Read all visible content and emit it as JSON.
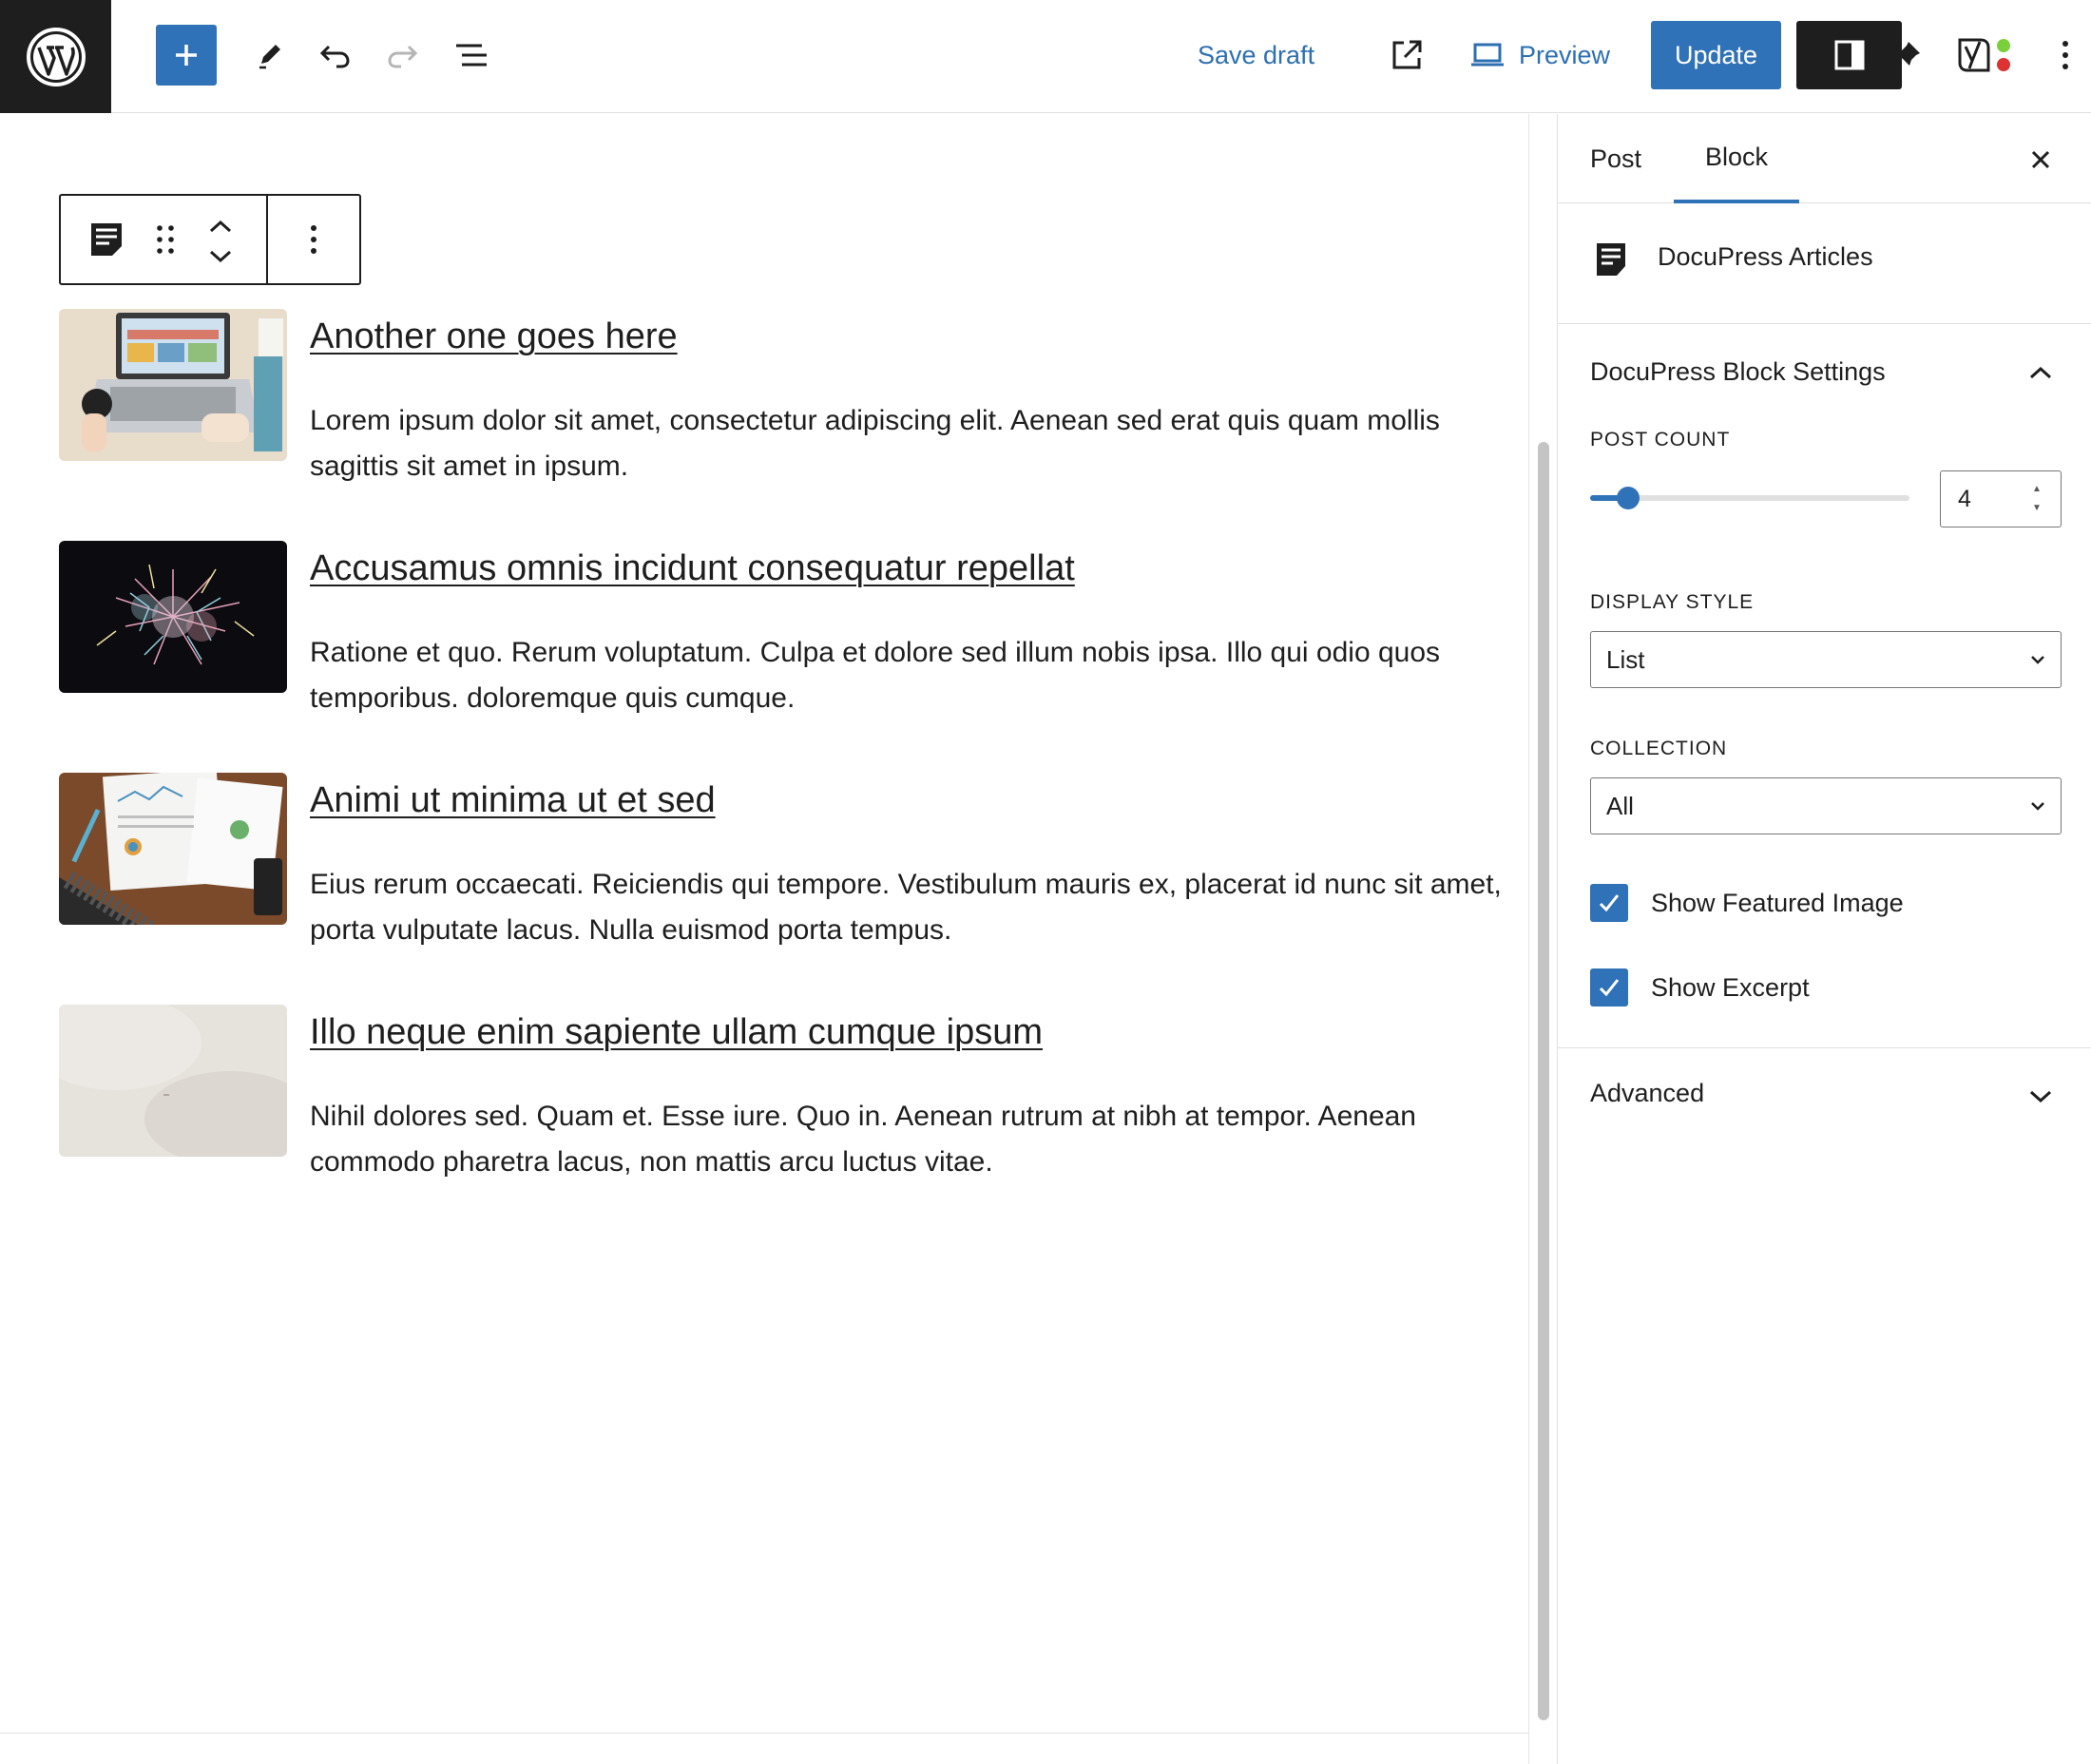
{
  "toolbar": {
    "save_draft_label": "Save draft",
    "preview_label": "Preview",
    "update_label": "Update",
    "accent_color": "#3072b8"
  },
  "articles": [
    {
      "title": "Another one goes here",
      "excerpt": "Lorem ipsum dolor sit amet, consectetur adipiscing elit. Aenean sed erat quis quam mollis sagittis sit amet in ipsum.",
      "image": "laptop-desk-photo"
    },
    {
      "title": "Accusamus omnis incidunt consequatur repellat",
      "excerpt": "Ratione et quo. Rerum voluptatum. Culpa et dolore sed illum nobis ipsa. Illo qui odio quos temporibus. doloremque quis cumque.",
      "image": "fireworks-photo"
    },
    {
      "title": "Animi ut minima ut et sed",
      "excerpt": "Eius rerum occaecati. Reiciendis qui tempore. Vestibulum mauris ex, placerat id nunc sit amet, porta vulputate lacus. Nulla euismod porta tempus.",
      "image": "analytics-papers-photo"
    },
    {
      "title": "Illo neque enim sapiente ullam cumque ipsum",
      "excerpt": "Nihil dolores sed. Quam et. Esse iure. Quo in. Aenean rutrum at nibh at tempor. Aenean commodo pharetra lacus, non mattis arcu luctus vitae.",
      "image": "pale-texture-photo"
    }
  ],
  "sidebar": {
    "tab_post": "Post",
    "tab_block": "Block",
    "block_name": "DocuPress Articles",
    "settings_panel_title": "DocuPress Block Settings",
    "post_count_label": "Post count",
    "post_count_value": "4",
    "post_count_fraction": 0.12,
    "display_style_label": "Display style",
    "display_style_value": "List",
    "collection_label": "Collection",
    "collection_value": "All",
    "show_featured_image_label": "Show Featured Image",
    "show_featured_image_checked": true,
    "show_excerpt_label": "Show Excerpt",
    "show_excerpt_checked": true,
    "advanced_label": "Advanced"
  }
}
